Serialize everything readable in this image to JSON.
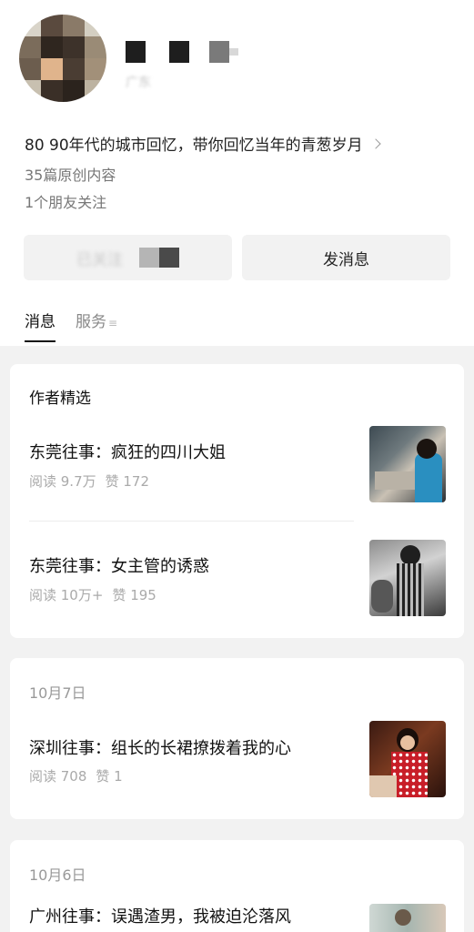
{
  "profile": {
    "location": "广东",
    "description": "80 90年代的城市回忆，带你回忆当年的青葱岁月",
    "article_count": "35篇原创内容",
    "friends_following": "1个朋友关注"
  },
  "actions": {
    "follow_label": "已关注",
    "message_label": "发消息"
  },
  "tabs": [
    {
      "label": "消息"
    },
    {
      "label": "服务",
      "glyph": "≡"
    }
  ],
  "featured": {
    "title": "作者精选",
    "articles": [
      {
        "title": "东莞往事：疯狂的四川大姐",
        "reads": "阅读 9.7万",
        "likes": "赞 172"
      },
      {
        "title": "东莞往事：女主管的诱惑",
        "reads": "阅读 10万+",
        "likes": "赞 195"
      }
    ]
  },
  "feed": [
    {
      "date": "10月7日",
      "title": "深圳往事：组长的长裙撩拨着我的心",
      "reads": "阅读 708",
      "likes": "赞 1"
    },
    {
      "date": "10月6日",
      "title": "广州往事：误遇渣男，我被迫沦落风"
    }
  ]
}
